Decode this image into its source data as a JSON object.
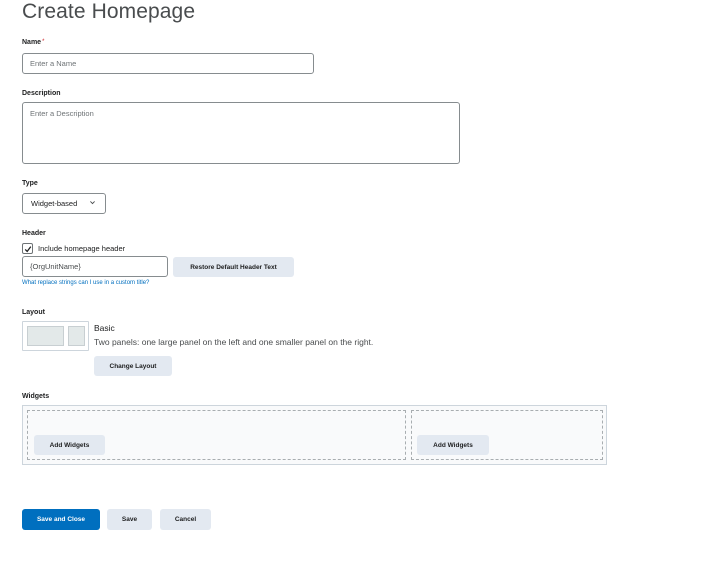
{
  "page": {
    "title": "Create Homepage"
  },
  "name_field": {
    "label": "Name",
    "required_marker": "*",
    "placeholder": "Enter a Name",
    "value": ""
  },
  "description_field": {
    "label": "Description",
    "placeholder": "Enter a Description",
    "value": ""
  },
  "type_field": {
    "label": "Type",
    "selected": "Widget-based",
    "chevron": "⌄"
  },
  "header_field": {
    "label": "Header",
    "checkbox_label": "Include homepage header",
    "checked": true,
    "value": "{OrgUnitName}",
    "restore_button": "Restore Default Header Text",
    "help_link": "What replace strings can I use in a custom title?"
  },
  "layout_field": {
    "label": "Layout",
    "name": "Basic",
    "description": "Two panels: one large panel on the left and one smaller panel on the right.",
    "change_button": "Change Layout"
  },
  "widgets_field": {
    "label": "Widgets",
    "panels": [
      {
        "add_button": "Add Widgets"
      },
      {
        "add_button": "Add Widgets"
      }
    ]
  },
  "footer": {
    "save_and_close": "Save and Close",
    "save": "Save",
    "cancel": "Cancel"
  },
  "colors": {
    "primary": "#006fbf",
    "secondary_button": "#e3e9f1",
    "link": "#006fbf",
    "required": "#cd2026"
  }
}
